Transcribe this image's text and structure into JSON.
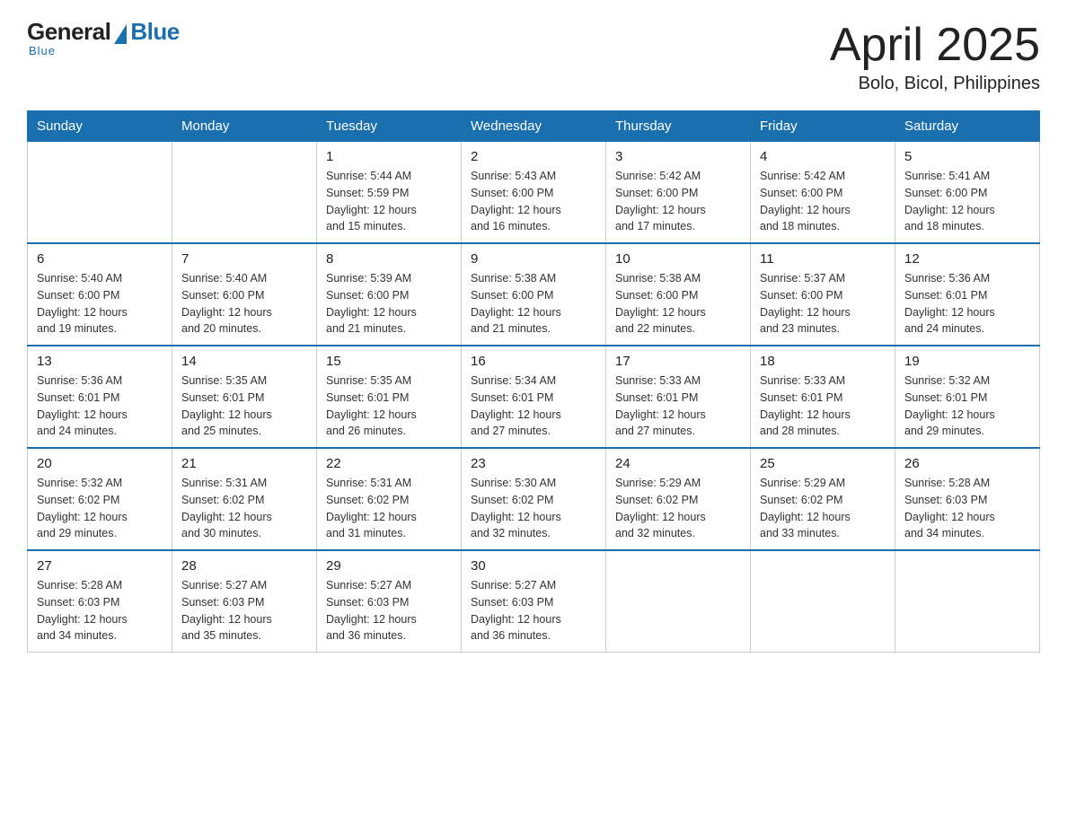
{
  "logo": {
    "general": "General",
    "blue": "Blue",
    "underline": "Blue"
  },
  "title": "April 2025",
  "subtitle": "Bolo, Bicol, Philippines",
  "headers": [
    "Sunday",
    "Monday",
    "Tuesday",
    "Wednesday",
    "Thursday",
    "Friday",
    "Saturday"
  ],
  "weeks": [
    [
      {
        "day": "",
        "info": ""
      },
      {
        "day": "",
        "info": ""
      },
      {
        "day": "1",
        "info": "Sunrise: 5:44 AM\nSunset: 5:59 PM\nDaylight: 12 hours\nand 15 minutes."
      },
      {
        "day": "2",
        "info": "Sunrise: 5:43 AM\nSunset: 6:00 PM\nDaylight: 12 hours\nand 16 minutes."
      },
      {
        "day": "3",
        "info": "Sunrise: 5:42 AM\nSunset: 6:00 PM\nDaylight: 12 hours\nand 17 minutes."
      },
      {
        "day": "4",
        "info": "Sunrise: 5:42 AM\nSunset: 6:00 PM\nDaylight: 12 hours\nand 18 minutes."
      },
      {
        "day": "5",
        "info": "Sunrise: 5:41 AM\nSunset: 6:00 PM\nDaylight: 12 hours\nand 18 minutes."
      }
    ],
    [
      {
        "day": "6",
        "info": "Sunrise: 5:40 AM\nSunset: 6:00 PM\nDaylight: 12 hours\nand 19 minutes."
      },
      {
        "day": "7",
        "info": "Sunrise: 5:40 AM\nSunset: 6:00 PM\nDaylight: 12 hours\nand 20 minutes."
      },
      {
        "day": "8",
        "info": "Sunrise: 5:39 AM\nSunset: 6:00 PM\nDaylight: 12 hours\nand 21 minutes."
      },
      {
        "day": "9",
        "info": "Sunrise: 5:38 AM\nSunset: 6:00 PM\nDaylight: 12 hours\nand 21 minutes."
      },
      {
        "day": "10",
        "info": "Sunrise: 5:38 AM\nSunset: 6:00 PM\nDaylight: 12 hours\nand 22 minutes."
      },
      {
        "day": "11",
        "info": "Sunrise: 5:37 AM\nSunset: 6:00 PM\nDaylight: 12 hours\nand 23 minutes."
      },
      {
        "day": "12",
        "info": "Sunrise: 5:36 AM\nSunset: 6:01 PM\nDaylight: 12 hours\nand 24 minutes."
      }
    ],
    [
      {
        "day": "13",
        "info": "Sunrise: 5:36 AM\nSunset: 6:01 PM\nDaylight: 12 hours\nand 24 minutes."
      },
      {
        "day": "14",
        "info": "Sunrise: 5:35 AM\nSunset: 6:01 PM\nDaylight: 12 hours\nand 25 minutes."
      },
      {
        "day": "15",
        "info": "Sunrise: 5:35 AM\nSunset: 6:01 PM\nDaylight: 12 hours\nand 26 minutes."
      },
      {
        "day": "16",
        "info": "Sunrise: 5:34 AM\nSunset: 6:01 PM\nDaylight: 12 hours\nand 27 minutes."
      },
      {
        "day": "17",
        "info": "Sunrise: 5:33 AM\nSunset: 6:01 PM\nDaylight: 12 hours\nand 27 minutes."
      },
      {
        "day": "18",
        "info": "Sunrise: 5:33 AM\nSunset: 6:01 PM\nDaylight: 12 hours\nand 28 minutes."
      },
      {
        "day": "19",
        "info": "Sunrise: 5:32 AM\nSunset: 6:01 PM\nDaylight: 12 hours\nand 29 minutes."
      }
    ],
    [
      {
        "day": "20",
        "info": "Sunrise: 5:32 AM\nSunset: 6:02 PM\nDaylight: 12 hours\nand 29 minutes."
      },
      {
        "day": "21",
        "info": "Sunrise: 5:31 AM\nSunset: 6:02 PM\nDaylight: 12 hours\nand 30 minutes."
      },
      {
        "day": "22",
        "info": "Sunrise: 5:31 AM\nSunset: 6:02 PM\nDaylight: 12 hours\nand 31 minutes."
      },
      {
        "day": "23",
        "info": "Sunrise: 5:30 AM\nSunset: 6:02 PM\nDaylight: 12 hours\nand 32 minutes."
      },
      {
        "day": "24",
        "info": "Sunrise: 5:29 AM\nSunset: 6:02 PM\nDaylight: 12 hours\nand 32 minutes."
      },
      {
        "day": "25",
        "info": "Sunrise: 5:29 AM\nSunset: 6:02 PM\nDaylight: 12 hours\nand 33 minutes."
      },
      {
        "day": "26",
        "info": "Sunrise: 5:28 AM\nSunset: 6:03 PM\nDaylight: 12 hours\nand 34 minutes."
      }
    ],
    [
      {
        "day": "27",
        "info": "Sunrise: 5:28 AM\nSunset: 6:03 PM\nDaylight: 12 hours\nand 34 minutes."
      },
      {
        "day": "28",
        "info": "Sunrise: 5:27 AM\nSunset: 6:03 PM\nDaylight: 12 hours\nand 35 minutes."
      },
      {
        "day": "29",
        "info": "Sunrise: 5:27 AM\nSunset: 6:03 PM\nDaylight: 12 hours\nand 36 minutes."
      },
      {
        "day": "30",
        "info": "Sunrise: 5:27 AM\nSunset: 6:03 PM\nDaylight: 12 hours\nand 36 minutes."
      },
      {
        "day": "",
        "info": ""
      },
      {
        "day": "",
        "info": ""
      },
      {
        "day": "",
        "info": ""
      }
    ]
  ]
}
